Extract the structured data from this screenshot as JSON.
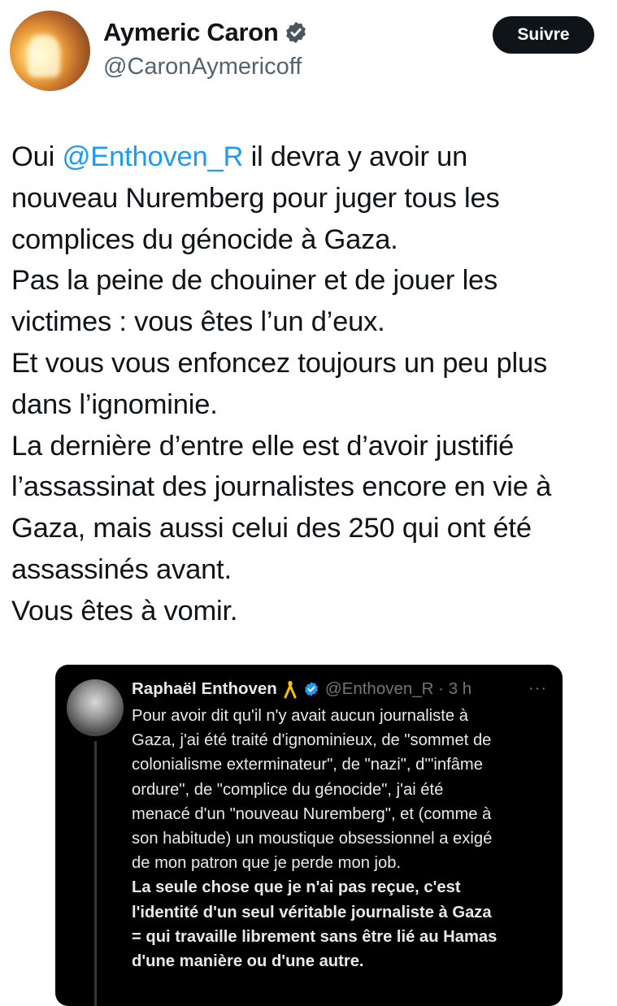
{
  "author": {
    "name": "Aymeric Caron",
    "handle": "@CaronAymericoff",
    "verified_icon": "verified-badge-icon"
  },
  "follow_button": {
    "label": "Suivre"
  },
  "tweet": {
    "lines": [
      {
        "pre": "Oui ",
        "mention": "@Enthoven_R",
        "post": " il devra y avoir un"
      },
      {
        "text": "nouveau Nuremberg pour juger tous les"
      },
      {
        "text": "complices du génocide à Gaza."
      },
      {
        "text": "Pas la peine de chouiner et de jouer les"
      },
      {
        "text": "victimes :  vous êtes l’un d’eux."
      },
      {
        "text": "Et vous vous enfoncez toujours un peu plus"
      },
      {
        "text": "dans l’ignominie."
      },
      {
        "text": "La dernière d’entre elle est d’avoir justifié"
      },
      {
        "text": "l’assassinat des journalistes encore en vie à"
      },
      {
        "text": "Gaza, mais aussi celui des 250 qui ont été"
      },
      {
        "text": "assassinés avant."
      },
      {
        "text": "Vous êtes à vomir."
      }
    ]
  },
  "quoted_tweet": {
    "author_name": "Raphaël Enthoven",
    "ribbon_icon": "yellow-ribbon-icon",
    "verified_icon": "verified-badge-icon",
    "handle_time": "@Enthoven_R · 3 h",
    "more_label": "···",
    "lines": [
      {
        "text": "Pour avoir dit qu'il n'y avait aucun journaliste à",
        "bold": false
      },
      {
        "text": "Gaza, j'ai été traité d'ignominieux, de \"sommet de",
        "bold": false
      },
      {
        "text": "colonialisme exterminateur\", de \"nazi\", d'\"infâme",
        "bold": false
      },
      {
        "text": "ordure\", de \"complice du génocide\", j'ai été",
        "bold": false
      },
      {
        "text": "menacé d'un \"nouveau Nuremberg\", et (comme à",
        "bold": false
      },
      {
        "text": "son habitude) un moustique obsessionnel a exigé",
        "bold": false
      },
      {
        "text": "de mon patron que je perde mon job.",
        "bold": false
      },
      {
        "text": "La seule chose que je n'ai pas reçue, c'est",
        "bold": true
      },
      {
        "text": "l'identité d'un seul véritable journaliste à Gaza",
        "bold": true
      },
      {
        "text": "= qui travaille librement sans être lié au Hamas",
        "bold": true
      },
      {
        "text": "d'une manière ou d'une autre.",
        "bold": true
      }
    ]
  },
  "colors": {
    "mention": "#1d9bf0",
    "verified": "#1d9bf0",
    "follow_bg": "#0f1419",
    "quote_bg": "#000000",
    "ribbon": "#f2c200"
  }
}
